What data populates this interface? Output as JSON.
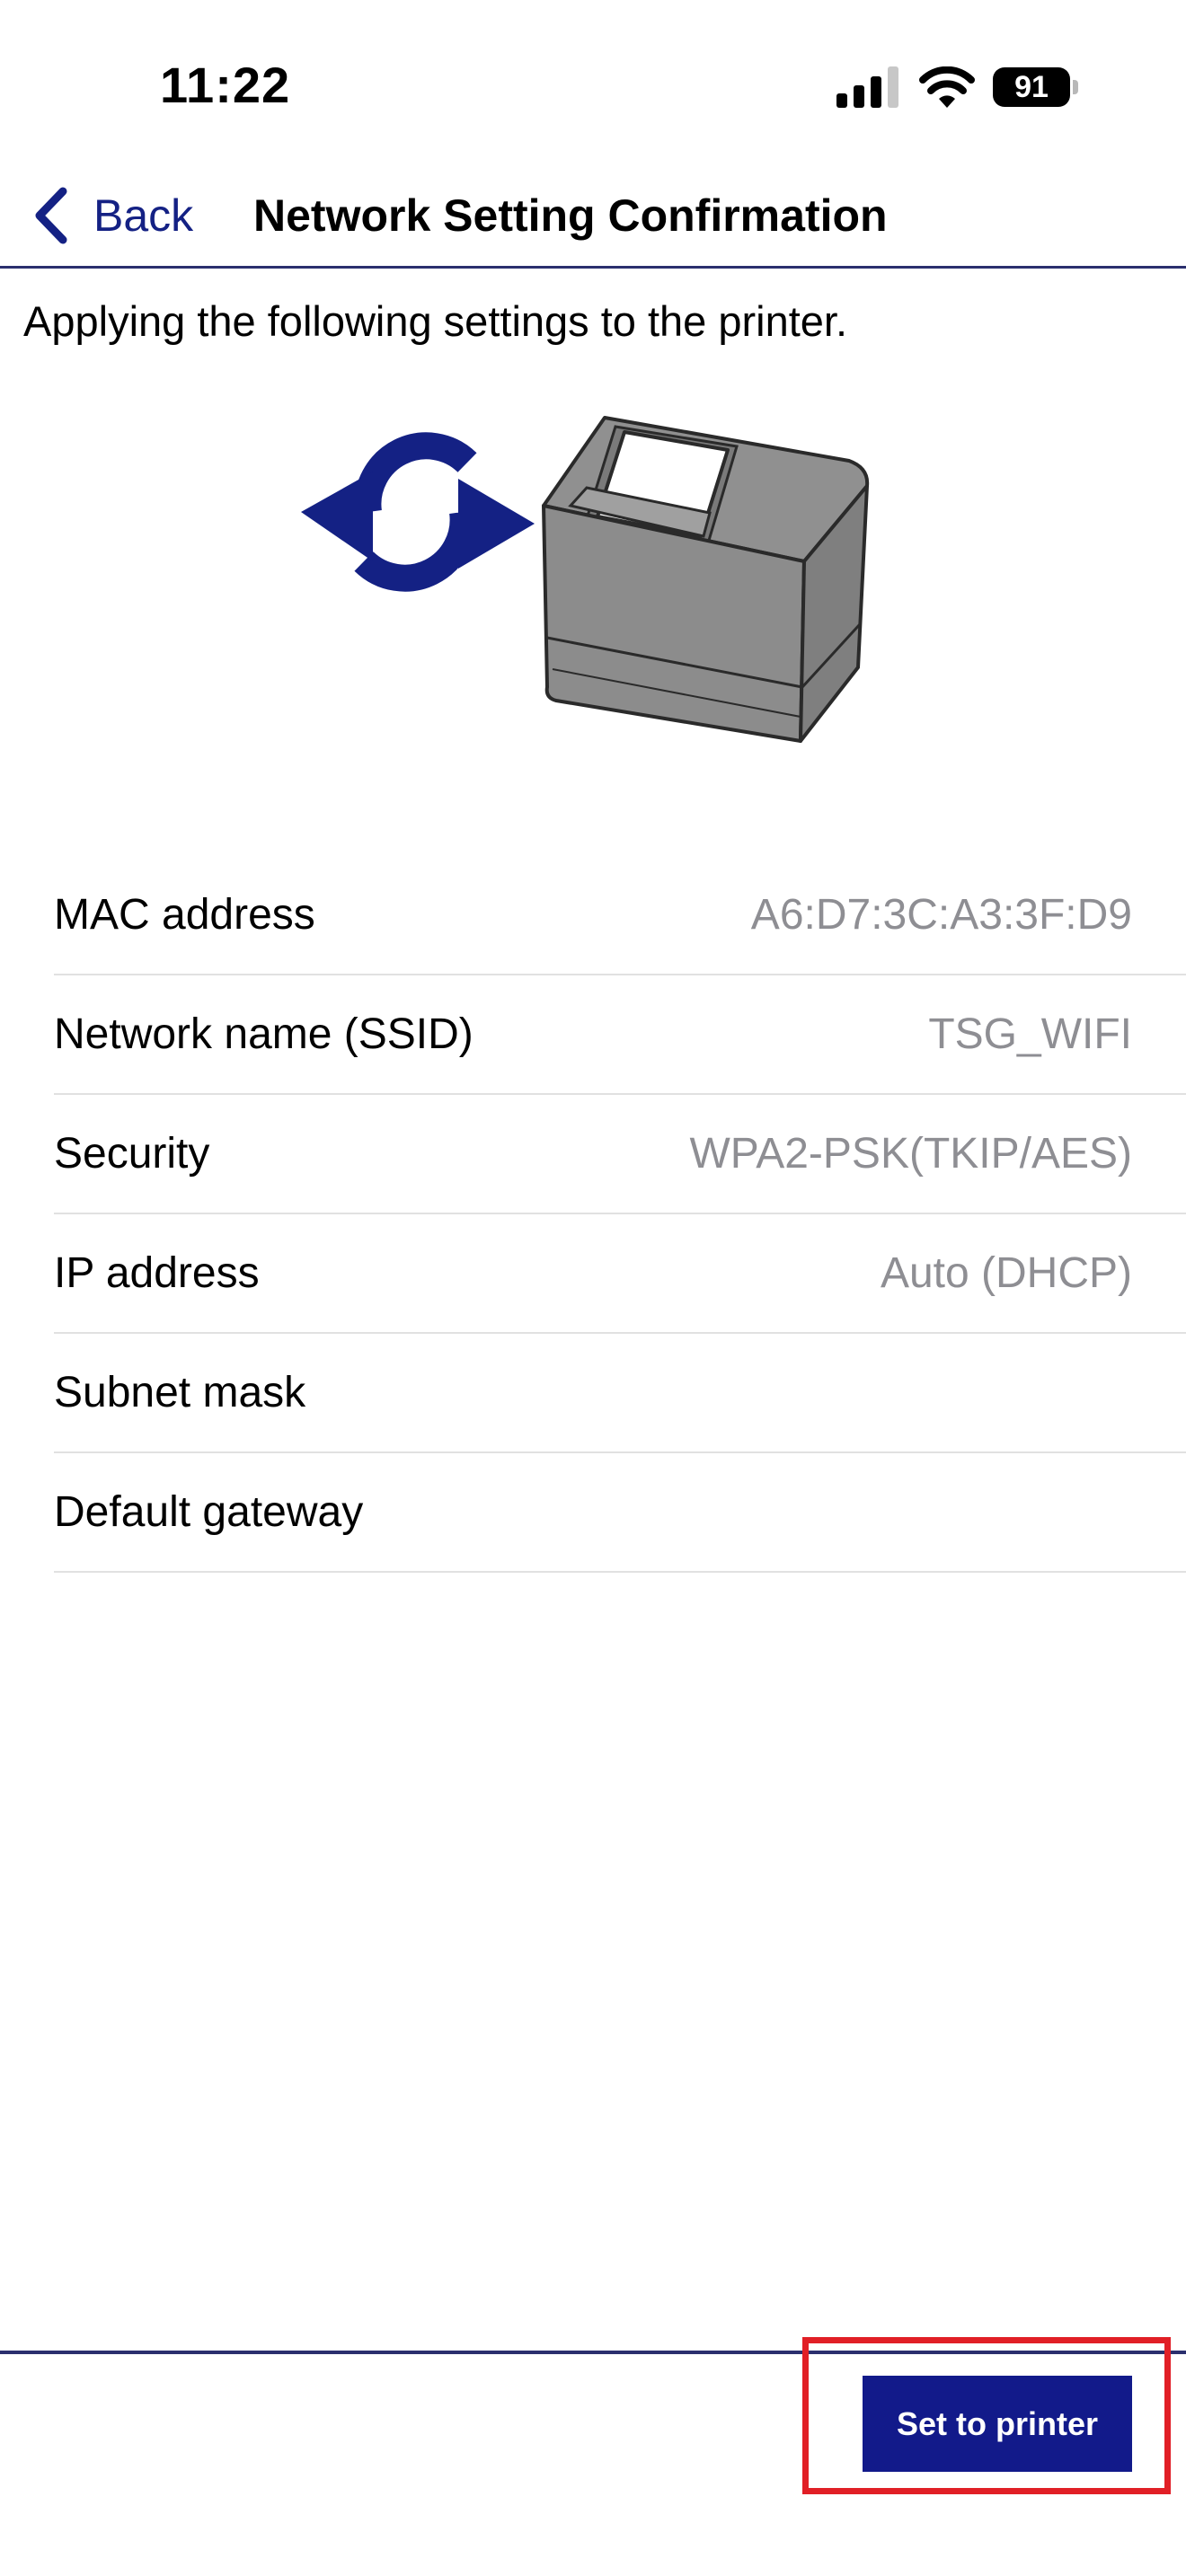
{
  "status_bar": {
    "time": "11:22",
    "battery_level": "91",
    "icons": [
      "signal-icon",
      "wifi-icon",
      "battery-icon"
    ]
  },
  "nav": {
    "back_label": "Back",
    "back_icon": "chevron-left-icon",
    "title": "Network Setting Confirmation"
  },
  "content": {
    "intro": "Applying the following settings to the printer.",
    "illustration_icons": [
      "sync-icon",
      "printer-image"
    ]
  },
  "settings": [
    {
      "label": "MAC address",
      "value": "A6:D7:3C:A3:3F:D9"
    },
    {
      "label": "Network name (SSID)",
      "value": "TSG_WIFI"
    },
    {
      "label": "Security",
      "value": "WPA2-PSK(TKIP/AES)"
    },
    {
      "label": "IP address",
      "value": "Auto (DHCP)"
    },
    {
      "label": "Subnet mask",
      "value": ""
    },
    {
      "label": "Default gateway",
      "value": ""
    }
  ],
  "footer": {
    "primary_button_label": "Set to printer"
  },
  "colors": {
    "accent": "#142184",
    "button_bg": "#121a8a",
    "divider": "#2b2f6e",
    "value_text": "#8e8e93",
    "highlight": "#e11f26",
    "sync_icon": "#142184",
    "printer_body": "#8c8c8c"
  }
}
